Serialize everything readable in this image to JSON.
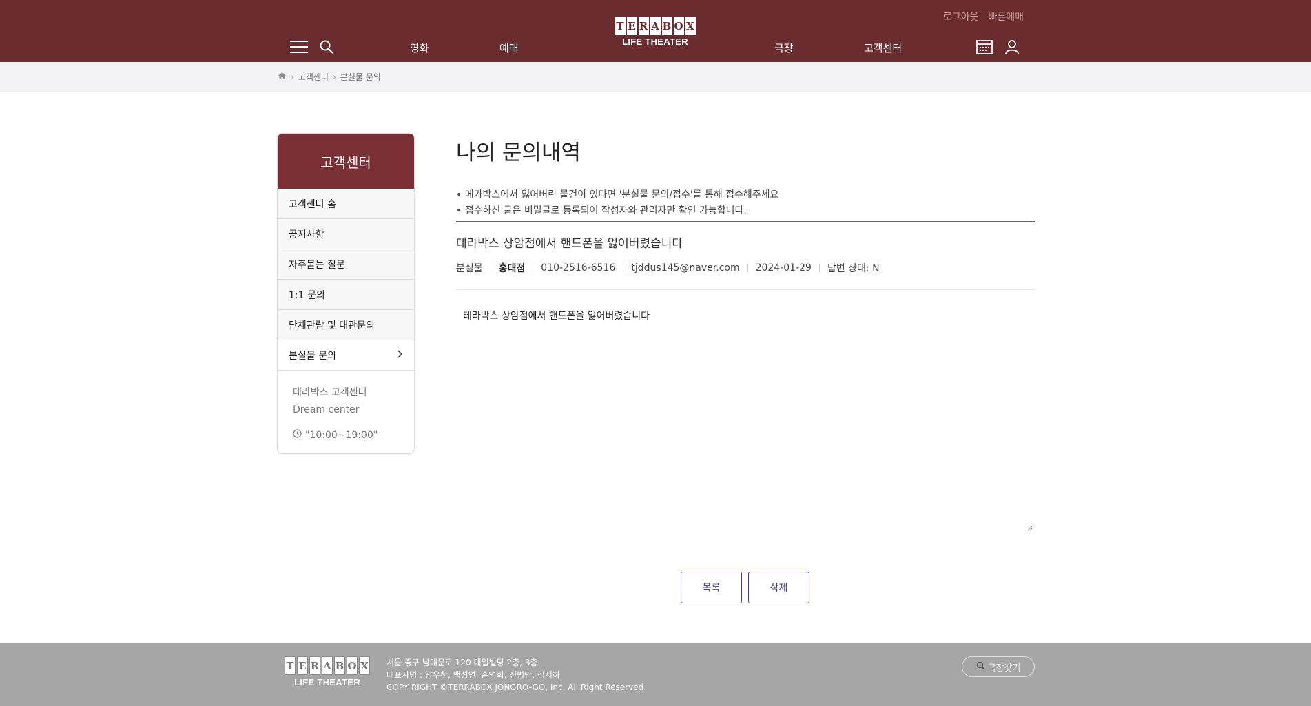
{
  "header": {
    "top_links": [
      "로그아웃",
      "빠른예매"
    ],
    "nav": [
      "영화",
      "예매",
      "극장",
      "고객센터"
    ],
    "logo_letters": [
      "T",
      "E",
      "R",
      "A",
      "B",
      "O",
      "X"
    ],
    "logo_sub": "LIFE THEATER",
    "icons": [
      "menu-icon",
      "search-icon",
      "calendar-icon",
      "user-icon"
    ],
    "bg_color": "#6b2c2f"
  },
  "breadcrumb": [
    "고객센터",
    "분실물 문의"
  ],
  "sidebar": {
    "title": "고객센터",
    "items": [
      "고객센터 홈",
      "공지사항",
      "자주묻는 질문",
      "1:1 문의",
      "단체관람 및 대관문의",
      "분실물 문의"
    ],
    "active_item": "분실물 문의",
    "info_name": "테라박스 고객센터",
    "info_sub": "Dream center",
    "hours": "\"10:00~19:00\""
  },
  "main": {
    "title": "나의 문의내역",
    "notices": [
      "• 메가박스에서 잃어버린 물건이 있다면 '분실물 문의/접수'를 통해 접수해주세요",
      "• 접수하신 글은 비밀글로 등록되어 작성자와 관리자만 확인 가능합니다."
    ],
    "subject": "테라박스 상암점에서 핸드폰을 잃어버렸습니다",
    "meta": {
      "category": "분실물",
      "theater": "홍대점",
      "phone": "010-2516-6516",
      "email": "tjddus145@naver.com",
      "date": "2024-01-29",
      "status": "답변 상태: N"
    },
    "content": "테라박스 상암점에서 핸드폰을 잃어버렸습니다",
    "buttons": {
      "list": "목록",
      "delete": "삭제"
    }
  },
  "footer": {
    "address": "서울 중구 남대문로 120 대일빌딩 2층, 3층",
    "ceo": "대표자명 : 양우찬, 백성연, 손연희, 진병만, 김서하",
    "copyright": "COPY RIGHT ©TERRABOX JONGRO-GO, Inc, All Right Reserved",
    "theater_search": "극장찾기"
  }
}
